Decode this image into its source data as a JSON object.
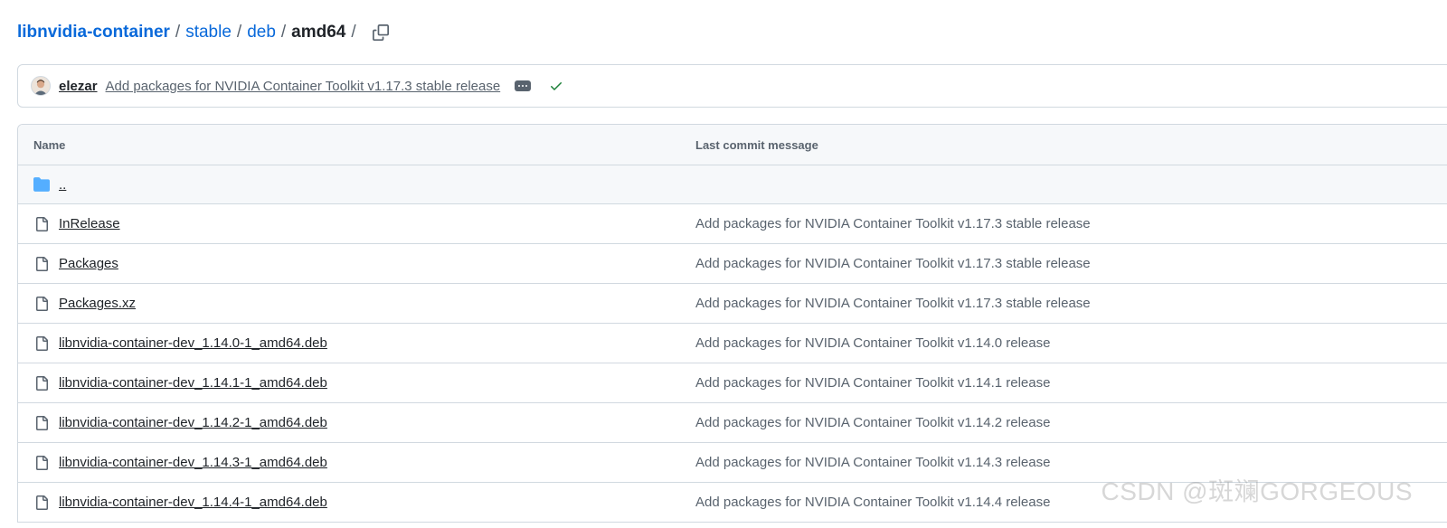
{
  "breadcrumb": {
    "root": "libnvidia-container",
    "parts": [
      "stable",
      "deb"
    ],
    "current": "amd64",
    "separator": "/"
  },
  "commit": {
    "author": "elezar",
    "message": "Add packages for NVIDIA Container Toolkit v1.17.3 stable release",
    "status": "success"
  },
  "table": {
    "headers": {
      "name": "Name",
      "message": "Last commit message"
    },
    "parent": "..",
    "rows": [
      {
        "name": "InRelease",
        "message": "Add packages for NVIDIA Container Toolkit v1.17.3 stable release"
      },
      {
        "name": "Packages",
        "message": "Add packages for NVIDIA Container Toolkit v1.17.3 stable release"
      },
      {
        "name": "Packages.xz",
        "message": "Add packages for NVIDIA Container Toolkit v1.17.3 stable release"
      },
      {
        "name": "libnvidia-container-dev_1.14.0-1_amd64.deb",
        "message": "Add packages for NVIDIA Container Toolkit v1.14.0 release"
      },
      {
        "name": "libnvidia-container-dev_1.14.1-1_amd64.deb",
        "message": "Add packages for NVIDIA Container Toolkit v1.14.1 release"
      },
      {
        "name": "libnvidia-container-dev_1.14.2-1_amd64.deb",
        "message": "Add packages for NVIDIA Container Toolkit v1.14.2 release"
      },
      {
        "name": "libnvidia-container-dev_1.14.3-1_amd64.deb",
        "message": "Add packages for NVIDIA Container Toolkit v1.14.3 release"
      },
      {
        "name": "libnvidia-container-dev_1.14.4-1_amd64.deb",
        "message": "Add packages for NVIDIA Container Toolkit v1.14.4 release"
      }
    ]
  },
  "watermark": "CSDN @斑斓GORGEOUS",
  "colors": {
    "link": "#0969da",
    "folder": "#54aeff",
    "success": "#1a7f37",
    "muted": "#59636e"
  }
}
